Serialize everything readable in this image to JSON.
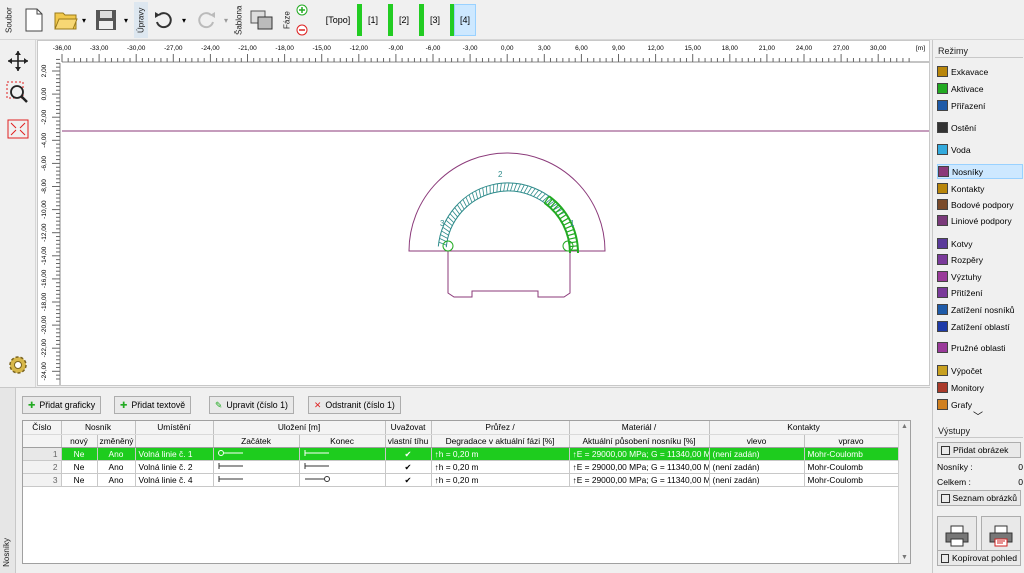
{
  "toolbar": {
    "soubor": "Soubor",
    "upravy": "Úpravy",
    "sablona": "Šablona",
    "faze": "Fáze",
    "phases": [
      {
        "label": "[Topo]",
        "active": false
      },
      {
        "label": "[1]",
        "active": false
      },
      {
        "label": "[2]",
        "active": false
      },
      {
        "label": "[3]",
        "active": false
      },
      {
        "label": "[4]",
        "active": true
      }
    ]
  },
  "ruler": {
    "x_labels": [
      "-36,00",
      "-33,00",
      "-30,00",
      "-27,00",
      "-24,00",
      "-21,00",
      "-18,00",
      "-15,00",
      "-12,00",
      "-9,00",
      "-6,00",
      "-3,00",
      "0,00",
      "3,00",
      "6,00",
      "9,00",
      "12,00",
      "15,00",
      "18,00",
      "21,00",
      "24,00",
      "27,00",
      "30,00"
    ],
    "x_unit": "[m]",
    "y_labels": [
      "2,00",
      "0,00",
      "-2,00",
      "-4,00",
      "-6,00",
      "-8,00",
      "-10,00",
      "-12,00",
      "-14,00",
      "-16,00",
      "-18,00",
      "-20,00",
      "-22,00",
      "-24,00"
    ]
  },
  "drawing": {
    "beam_labels": [
      "1",
      "2",
      "3"
    ],
    "line_color": "#8b3a7a",
    "beam_color": "#2e8b8b",
    "selected_color": "#22aa22"
  },
  "modes": {
    "header": "Režimy",
    "items": [
      {
        "label": "Exkavace",
        "icon": "excavation-icon",
        "active": false
      },
      {
        "label": "Aktivace",
        "icon": "activation-icon",
        "active": false
      },
      {
        "label": "Přiřazení",
        "icon": "assignment-icon",
        "active": false
      },
      {
        "label": "Ostění",
        "icon": "lining-icon",
        "active": false
      },
      {
        "label": "Voda",
        "icon": "water-icon",
        "active": false
      },
      {
        "label": "Nosníky",
        "icon": "beam-icon",
        "active": true
      },
      {
        "label": "Kontakty",
        "icon": "contact-icon",
        "active": false
      },
      {
        "label": "Bodové podpory",
        "icon": "point-support-icon",
        "active": false
      },
      {
        "label": "Liniové podpory",
        "icon": "line-support-icon",
        "active": false
      },
      {
        "label": "Kotvy",
        "icon": "anchor-icon",
        "active": false
      },
      {
        "label": "Rozpěry",
        "icon": "strut-icon",
        "active": false
      },
      {
        "label": "Výztuhy",
        "icon": "reinforcement-icon",
        "active": false
      },
      {
        "label": "Přitížení",
        "icon": "surcharge-icon",
        "active": false
      },
      {
        "label": "Zatížení nosníků",
        "icon": "beam-load-icon",
        "active": false
      },
      {
        "label": "Zatížení oblastí",
        "icon": "region-load-icon",
        "active": false
      },
      {
        "label": "Pružné oblasti",
        "icon": "elastic-region-icon",
        "active": false
      },
      {
        "label": "Výpočet",
        "icon": "calculation-icon",
        "active": false
      },
      {
        "label": "Monitory",
        "icon": "monitor-icon",
        "active": false
      },
      {
        "label": "Grafy",
        "icon": "graph-icon",
        "active": false
      }
    ]
  },
  "outputs": {
    "header": "Výstupy",
    "add_picture": "Přidat obrázek",
    "beams_label": "Nosníky :",
    "beams_value": "0",
    "total_label": "Celkem :",
    "total_value": "0",
    "picture_list": "Seznam obrázků",
    "copy_view": "Kopírovat pohled"
  },
  "actions": {
    "add_graphic": "Přidat graficky",
    "add_text": "Přidat textově",
    "edit": "Upravit (číslo 1)",
    "remove": "Odstranit (číslo 1)"
  },
  "side_tab": "Nosníky",
  "table": {
    "h1": [
      "Číslo",
      "Nosník",
      "Umístění",
      "Uložení [m]",
      "Uvažovat",
      "Průřez /",
      "Materiál /",
      "Kontakty"
    ],
    "h2": [
      "",
      "nový",
      "změněný",
      "",
      "Začátek",
      "Konec",
      "vlastní tíhu",
      "Degradace v aktuální fázi [%]",
      "Aktuální působení nosníku [%]",
      "vlevo",
      "vpravo"
    ],
    "rows": [
      {
        "num": "1",
        "novy": "Ne",
        "zmeneny": "Ano",
        "umisteni": "Volná linie č. 1",
        "tiha": "✔",
        "prurez": "↑h = 0,20 m",
        "material": "↑E = 29000,00 MPa; G = 11340,00 M",
        "vlevo": "(není zadán)",
        "vpravo": "Mohr-Coulomb",
        "selected": true
      },
      {
        "num": "2",
        "novy": "Ne",
        "zmeneny": "Ano",
        "umisteni": "Volná linie č. 2",
        "tiha": "✔",
        "prurez": "↑h = 0,20 m",
        "material": "↑E = 29000,00 MPa; G = 11340,00 M",
        "vlevo": "(není zadán)",
        "vpravo": "Mohr-Coulomb",
        "selected": false
      },
      {
        "num": "3",
        "novy": "Ne",
        "zmeneny": "Ano",
        "umisteni": "Volná linie č. 4",
        "tiha": "✔",
        "prurez": "↑h = 0,20 m",
        "material": "↑E = 29000,00 MPa; G = 11340,00 M",
        "vlevo": "(není zadán)",
        "vpravo": "Mohr-Coulomb",
        "selected": false
      }
    ]
  }
}
